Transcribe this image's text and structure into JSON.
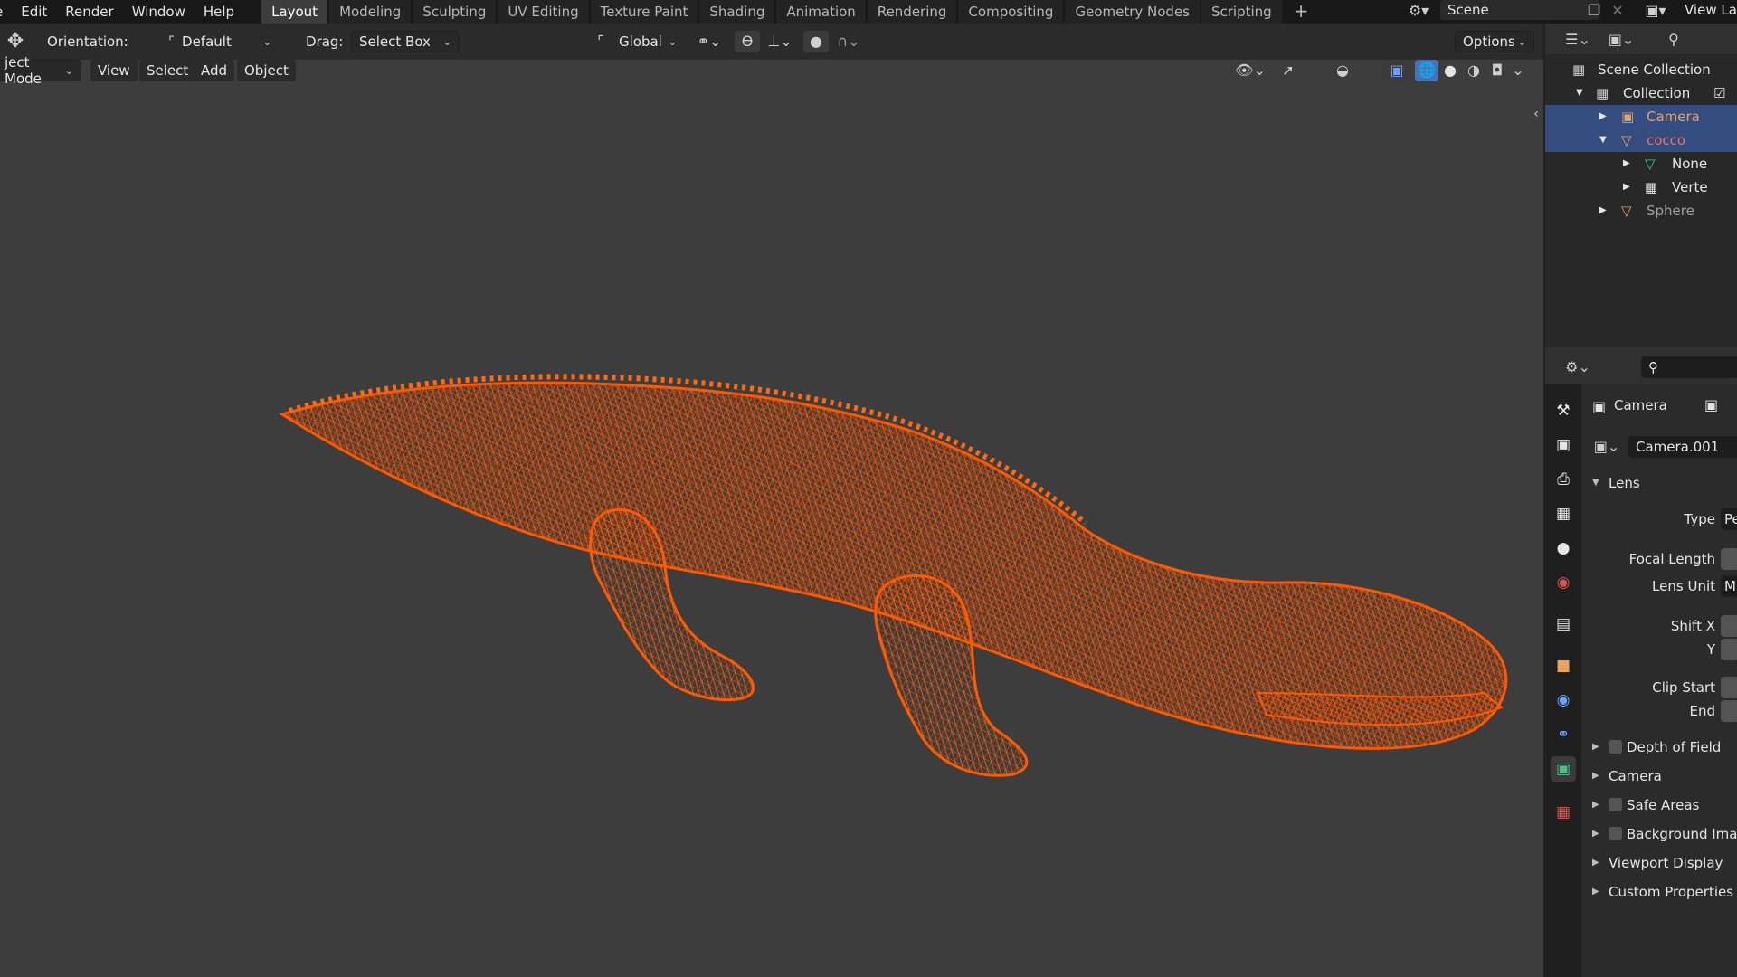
{
  "menu": [
    "e",
    "Edit",
    "Render",
    "Window",
    "Help"
  ],
  "workspace_tabs": [
    "Layout",
    "Modeling",
    "Sculpting",
    "UV Editing",
    "Texture Paint",
    "Shading",
    "Animation",
    "Rendering",
    "Compositing",
    "Geometry Nodes",
    "Scripting"
  ],
  "active_tab": "Layout",
  "scene": {
    "name": "Scene",
    "view_layer": "View La"
  },
  "toolbar": {
    "orientation_label": "Orientation:",
    "orientation_value": "Default",
    "drag_label": "Drag:",
    "drag_value": "Select Box",
    "transform_value": "Global",
    "options_label": "Options"
  },
  "header": {
    "mode": "ject Mode",
    "menus": [
      "View",
      "Select",
      "Add",
      "Object"
    ]
  },
  "outliner": {
    "items": [
      {
        "label": "Scene Collection",
        "level": 0
      },
      {
        "label": "Collection",
        "level": 1
      },
      {
        "label": "Camera",
        "level": 2,
        "selected": true
      },
      {
        "label": "cocco",
        "level": 2,
        "selected": true
      },
      {
        "label": "None",
        "level": 3
      },
      {
        "label": "Verte",
        "level": 3
      },
      {
        "label": "Sphere",
        "level": 2
      }
    ]
  },
  "properties": {
    "breadcrumb": "Camera",
    "datablock": "Camera.001",
    "lens_panel": "Lens",
    "type_label": "Type",
    "type_value": "Persp",
    "focal_length_label": "Focal Length",
    "lens_unit_label": "Lens Unit",
    "lens_unit_value": "Millim",
    "shift_x_label": "Shift X",
    "y_label": "Y",
    "clip_start_label": "Clip Start",
    "end_label": "End",
    "panels": [
      "Depth of Field",
      "Camera",
      "Safe Areas",
      "Background Imag",
      "Viewport Display",
      "Custom Properties"
    ]
  },
  "colors": {
    "wireframe": "#ff5a00",
    "selection_row": "#334d80",
    "active_orange": "#e8a35f"
  }
}
